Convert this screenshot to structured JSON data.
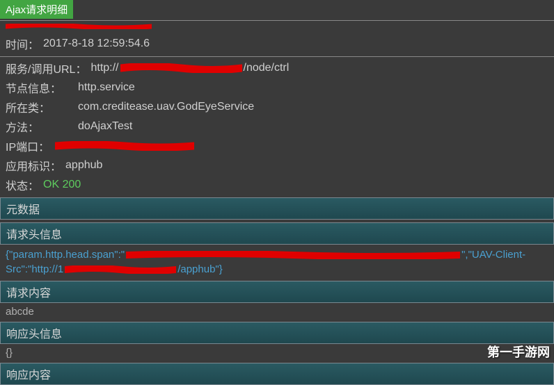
{
  "title": "Ajax请求明细",
  "info": {
    "time_label": "时间：",
    "time_value": "2017-8-18 12:59:54.6",
    "service_url_label": "服务/调用URL：",
    "service_url_prefix": "http://",
    "service_url_suffix": "/node/ctrl",
    "node_info_label": "节点信息：",
    "node_info_value": "http.service",
    "class_label": "所在类：",
    "class_value": "com.creditease.uav.GodEyeService",
    "method_label": "方法：",
    "method_value": "doAjaxTest",
    "ip_port_label": "IP端口：",
    "app_id_label": "应用标识：",
    "app_id_value": "apphub",
    "status_label": "状态：",
    "status_value": "OK 200"
  },
  "sections": {
    "metadata": "元数据",
    "request_headers": "请求头信息",
    "request_headers_content_prefix": "{\"param.http.head.span\":\"",
    "request_headers_content_mid": "\",\"UAV-Client-",
    "request_headers_content_src": "Src\":\"http://1",
    "request_headers_content_suffix": "/apphub\"}",
    "request_body": "请求内容",
    "request_body_content": "abcde",
    "response_headers": "响应头信息",
    "response_headers_content": "{}",
    "response_body": "响应内容"
  },
  "watermark": "第一手游网"
}
